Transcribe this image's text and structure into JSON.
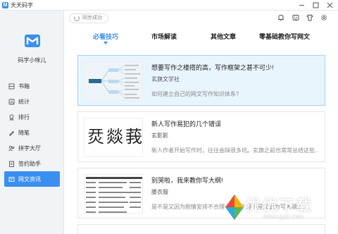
{
  "window": {
    "title": "天天码字",
    "app_icon_letter": "M"
  },
  "sidebar": {
    "username": "码字小咪儿",
    "items": [
      {
        "label": "书箱",
        "icon": "bookshelf-icon",
        "active": false
      },
      {
        "label": "统计",
        "icon": "stats-icon",
        "active": false
      },
      {
        "label": "排行",
        "icon": "ranking-icon",
        "active": false
      },
      {
        "label": "随笔",
        "icon": "notes-icon",
        "active": false
      },
      {
        "label": "拼字大厅",
        "icon": "hall-icon",
        "active": false
      },
      {
        "label": "签约助手",
        "icon": "contract-icon",
        "active": false
      },
      {
        "label": "网文资讯",
        "icon": "news-icon",
        "active": true
      }
    ]
  },
  "toolbar": {
    "sync_label": "同步成功",
    "icons": [
      "bell-icon",
      "skin-icon",
      "shirt-icon",
      "settings-icon"
    ]
  },
  "tabs": [
    {
      "label": "必看技巧",
      "active": true
    },
    {
      "label": "市场解读",
      "active": false
    },
    {
      "label": "其他文章",
      "active": false
    },
    {
      "label": "零基础教你写网文",
      "active": false
    }
  ],
  "articles": [
    {
      "title": "想要写作之楼搭的高，写作框架之甚不可少!",
      "author": "玄旗文学社",
      "desc": "如何建立自己的网文写作知识体系?",
      "highlight": true
    },
    {
      "title": "新人写作易犯的几个错误",
      "author": "玄影影",
      "desc": "新人作者开始写作时，往往会踩很多坑。玄旗之前也常常总结这些...",
      "highlight": false,
      "thumb_chars": [
        "烎",
        "燚",
        "莪"
      ]
    },
    {
      "title": "别哭啦，我来教你写大纲!",
      "author": "腰衣服",
      "desc": "是不是又因为剧情安排不合理卡文啦? 是不是又要为写大纲而...",
      "highlight": false
    }
  ],
  "watermark": {
    "text": "优优下载",
    "url": "www.yyxt.com"
  },
  "colors": {
    "accent": "#3b8ff0",
    "highlight_bg": "#e9f5fd",
    "highlight_border": "#9dd4f3",
    "sidebar_bg": "#f1f4f7"
  }
}
